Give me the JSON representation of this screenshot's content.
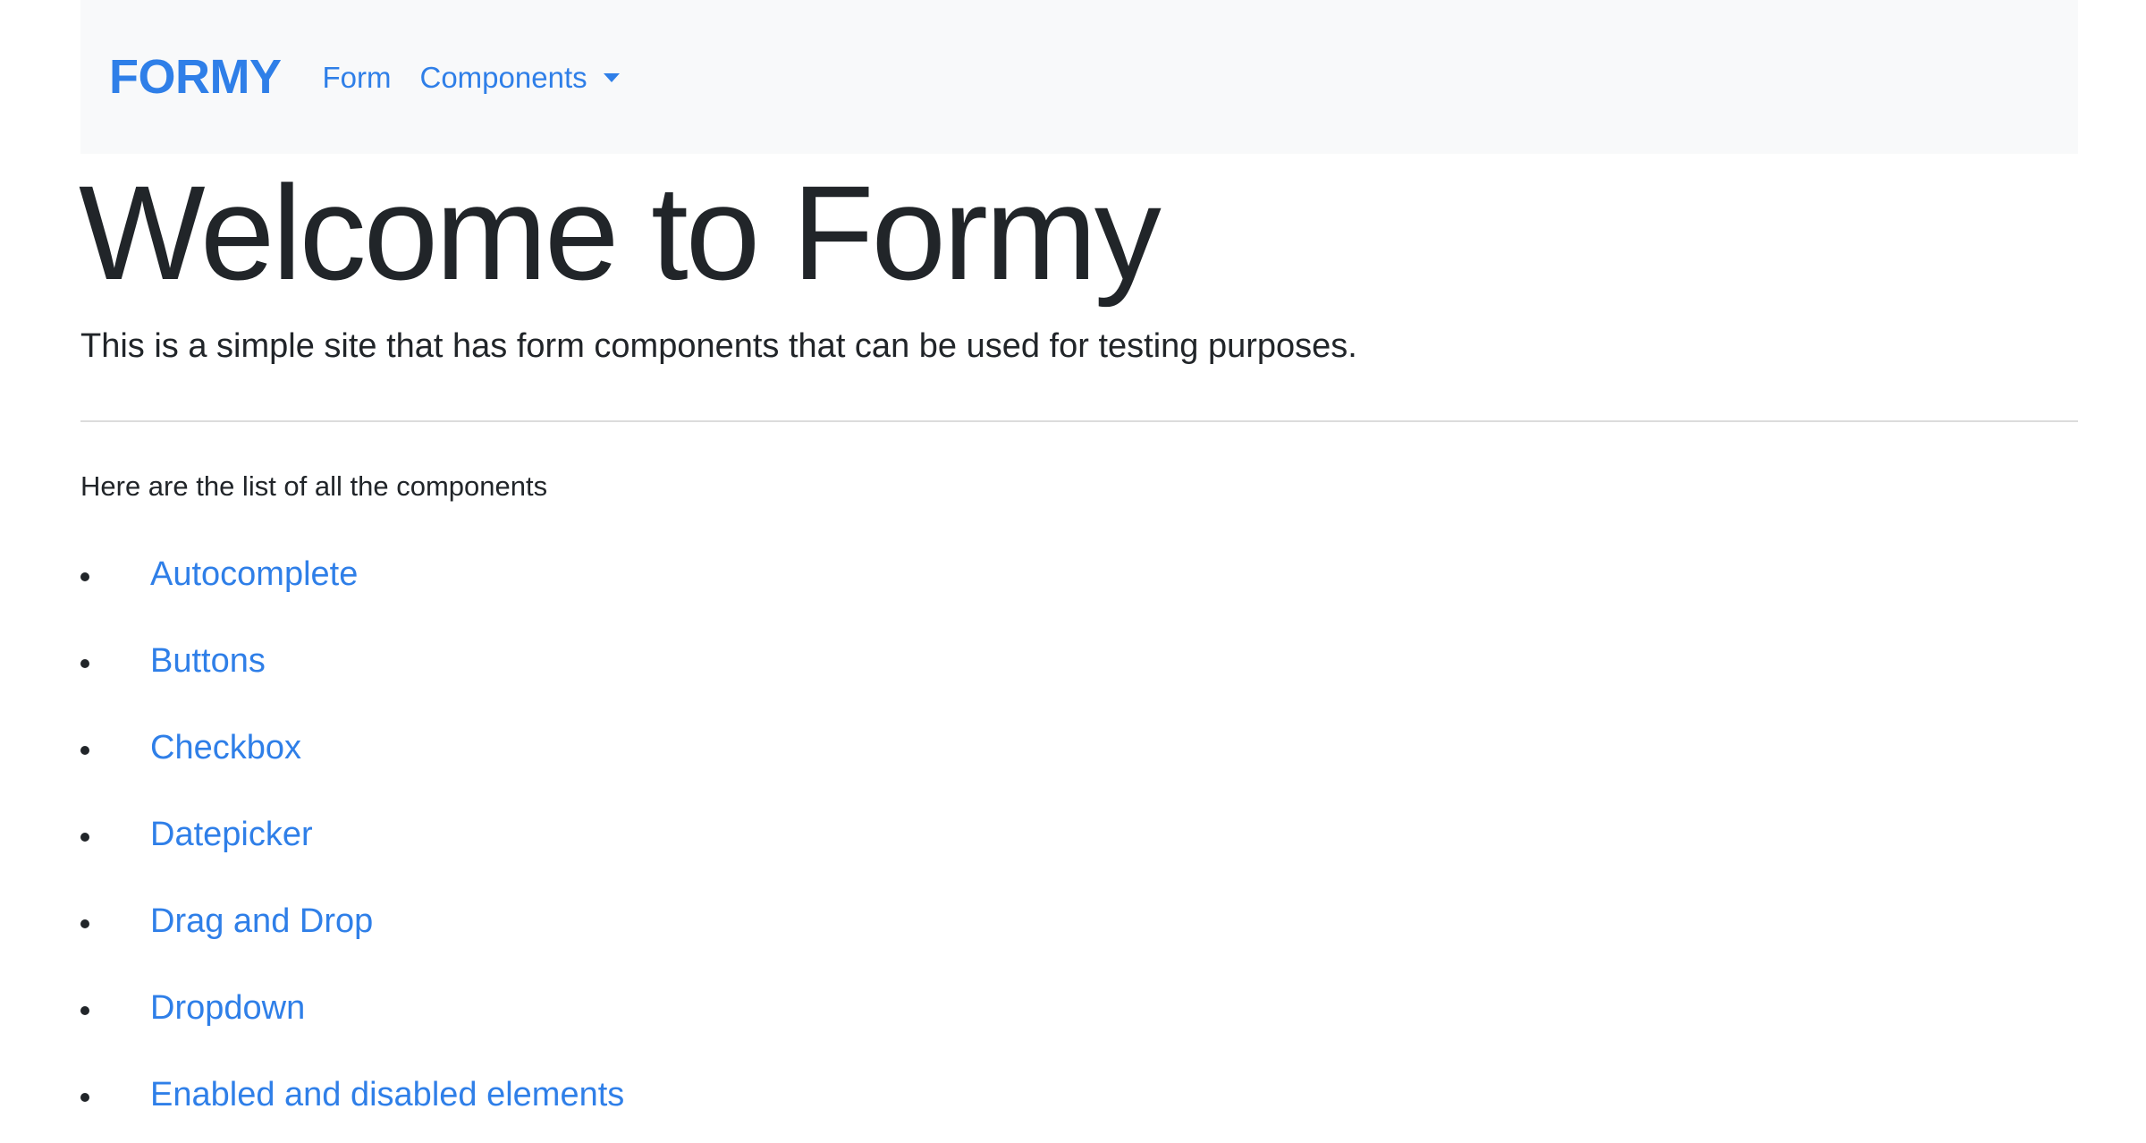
{
  "navbar": {
    "brand": "FORMY",
    "form_link": "Form",
    "components_dropdown": "Components"
  },
  "hero": {
    "title": "Welcome to Formy",
    "lead": "This is a simple site that has form components that can be used for testing purposes."
  },
  "intro": "Here are the list of all the components",
  "components": [
    {
      "label": "Autocomplete"
    },
    {
      "label": "Buttons"
    },
    {
      "label": "Checkbox"
    },
    {
      "label": "Datepicker"
    },
    {
      "label": "Drag and Drop"
    },
    {
      "label": "Dropdown"
    },
    {
      "label": "Enabled and disabled elements"
    }
  ],
  "colors": {
    "accent": "#2f7fe8",
    "navbar_bg": "#f8f9fa",
    "text": "#212529"
  }
}
